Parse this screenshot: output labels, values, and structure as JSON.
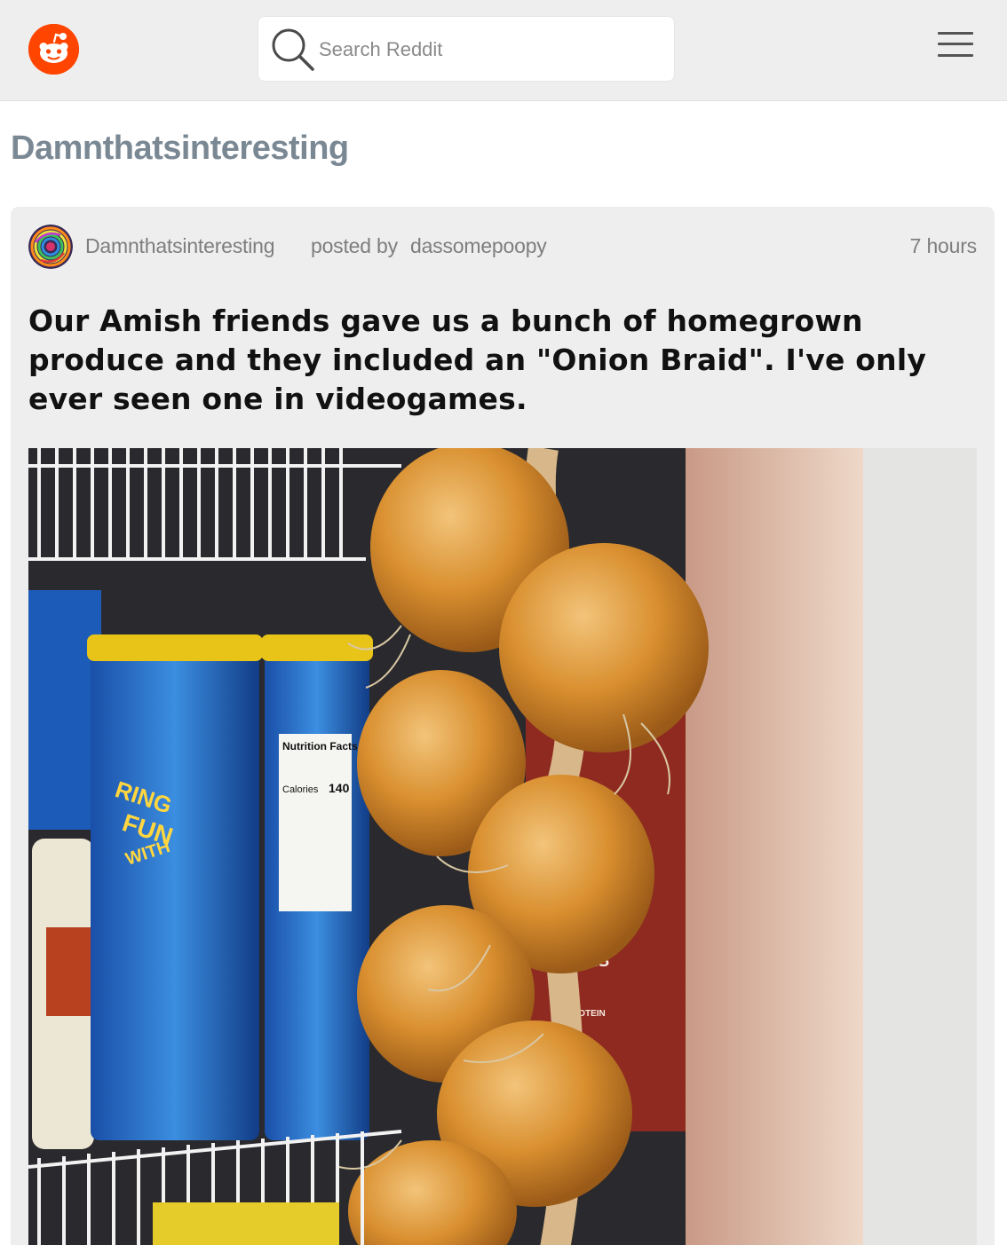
{
  "header": {
    "logo_icon": "reddit-alien-icon",
    "search": {
      "icon": "search-icon",
      "placeholder": "Search Reddit",
      "value": ""
    },
    "menu_icon": "hamburger-menu-icon"
  },
  "subreddit": {
    "title": "Damnthatsinteresting"
  },
  "post": {
    "subreddit": "Damnthatsinteresting",
    "posted_by_label": "posted by",
    "author": "dassomepoopy",
    "time": "7 hours",
    "title": "Our Amish friends gave us a bunch of homegrown produce and they included an \"Onion Braid\". I've only ever seen one in videogames.",
    "image": {
      "visible_text": [
        "Nutrition Facts",
        "Calories",
        "140",
        "FUN",
        "WITH",
        "RING",
        "AKS",
        "ROTEIN"
      ]
    }
  },
  "colors": {
    "brand": "#ff4500",
    "topbar_bg": "#eeeeee",
    "subreddit_title": "#7a8894",
    "card_bg": "#eeeeee",
    "meta_text": "#7e7e7e",
    "title_text": "#111111"
  }
}
